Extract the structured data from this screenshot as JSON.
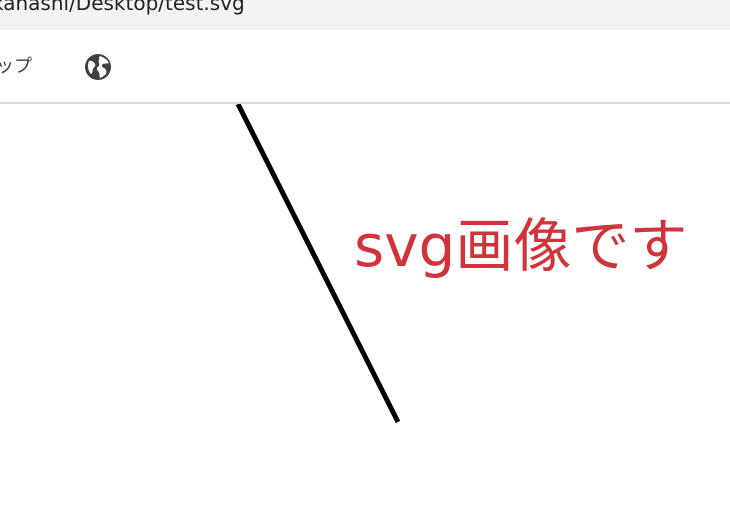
{
  "address_bar": {
    "url_text": "kanashi/Desktop/test.svg"
  },
  "bookmarks_bar": {
    "partial_item_label": "ップ",
    "globe_icon": "globe-icon"
  },
  "svg_document": {
    "caption_text": "svg画像です",
    "caption_color": "#d0343a",
    "line_color": "#000000"
  }
}
